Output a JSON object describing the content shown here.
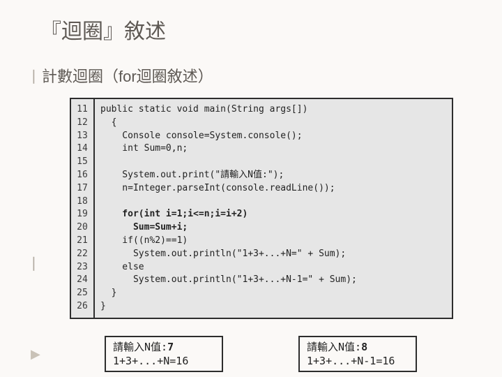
{
  "title": "『迴圈』敘述",
  "sub": "計數迴圈（for迴圈敘述）",
  "code": {
    "start": 11,
    "lines": [
      "public static void main(String args[])",
      "  {",
      "    Console console=System.console();",
      "    int Sum=0,n;",
      "",
      "    System.out.print(\"請輸入N值:\");",
      "    n=Integer.parseInt(console.readLine());",
      "",
      "    for(int i=1;i<=n;i=i+2)",
      "      Sum=Sum+i;",
      "    if((n%2)==1)",
      "      System.out.println(\"1+3+...+N=\" + Sum);",
      "    else",
      "      System.out.println(\"1+3+...+N-1=\" + Sum);",
      "  }",
      "}"
    ],
    "bold_indices": [
      8,
      9
    ]
  },
  "out1": {
    "prompt": "請輸入N值:",
    "val": "7",
    "result": "1+3+...+N=16"
  },
  "out2": {
    "prompt": "請輸入N值:",
    "val": "8",
    "result": "1+3+...+N-1=16"
  }
}
